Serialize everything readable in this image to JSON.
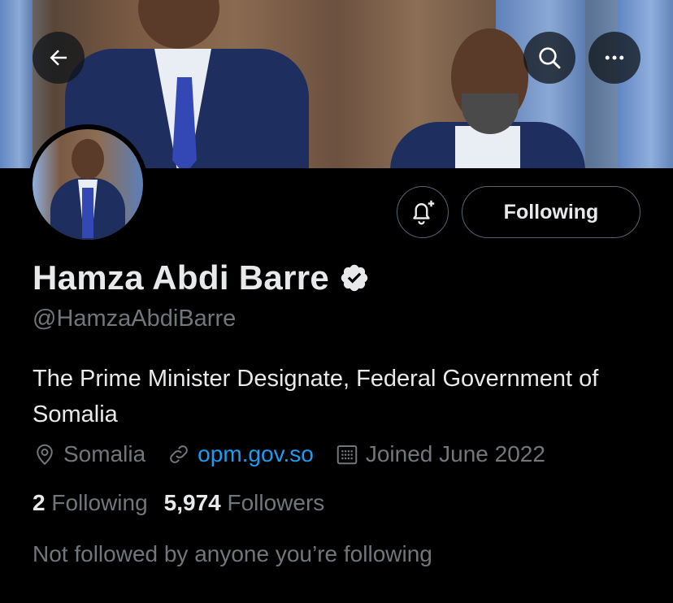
{
  "profile": {
    "name": "Hamza Abdi Barre",
    "handle": "@HamzaAbdiBarre",
    "bio": "The Prime Minister Designate, Federal Government of Somalia",
    "location": "Somalia",
    "website": "opm.gov.so",
    "joined": "Joined June 2022",
    "following_count": "2",
    "following_label": "Following",
    "followers_count": "5,974",
    "followers_label": "Followers",
    "not_followed_text": "Not followed by anyone you’re following",
    "verified": true
  },
  "actions": {
    "following_button_label": "Following"
  },
  "icons": {
    "back": "back-arrow-icon",
    "search": "search-icon",
    "more": "more-icon",
    "notify": "bell-plus-icon",
    "verified": "verified-badge-icon",
    "location": "location-pin-icon",
    "link": "link-icon",
    "calendar": "calendar-icon"
  },
  "colors": {
    "background": "#000000",
    "text_primary": "#e7e9ea",
    "text_secondary": "#71767b",
    "link": "#1d9bf0",
    "border": "#536471"
  }
}
